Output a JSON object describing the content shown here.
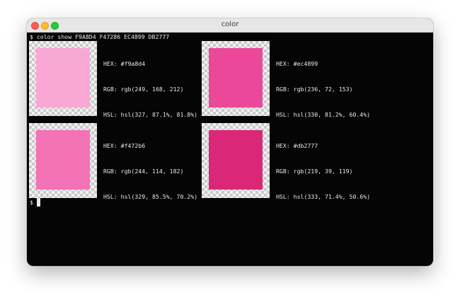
{
  "window": {
    "title": "color"
  },
  "terminal": {
    "command": "$ color show F9A8D4 F47286 EC4899 DB2777",
    "prompt": "$",
    "colors": [
      {
        "hex": "HEX: #f9a8d4",
        "rgb": "RGB: rgb(249, 168, 212)",
        "hsl": "HSL: hsl(327, 87.1%, 81.8%)",
        "swatch": "#f9a8d4"
      },
      {
        "hex": "HEX: #ec4899",
        "rgb": "RGB: rgb(236, 72, 153)",
        "hsl": "HSL: hsl(330, 81.2%, 60.4%)",
        "swatch": "#ec4899"
      },
      {
        "hex": "HEX: #f472b6",
        "rgb": "RGB: rgb(244, 114, 182)",
        "hsl": "HSL: hsl(329, 85.5%, 70.2%)",
        "swatch": "#f472b6"
      },
      {
        "hex": "HEX: #db2777",
        "rgb": "RGB: rgb(219, 39, 119)",
        "hsl": "HSL: hsl(333, 71.4%, 50.6%)",
        "swatch": "#db2777"
      }
    ]
  }
}
